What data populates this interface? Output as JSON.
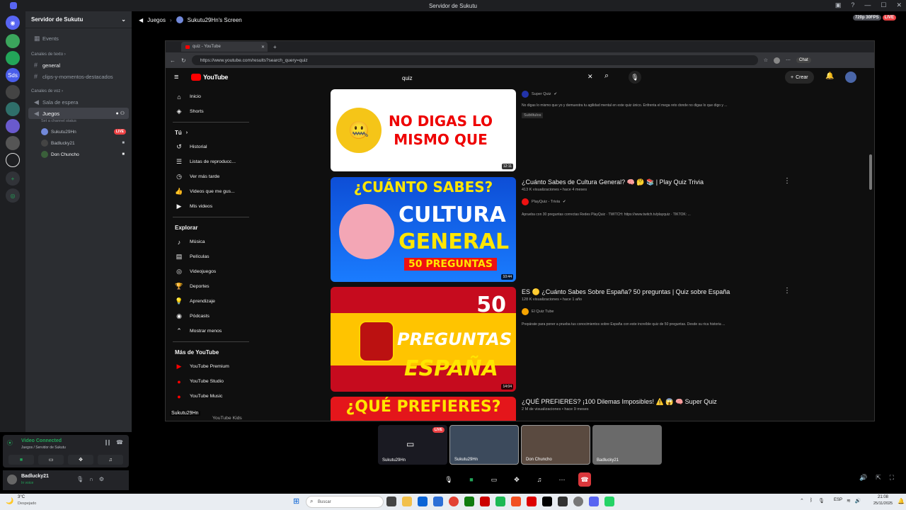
{
  "window": {
    "title": "Servidor de Sukutu"
  },
  "server": {
    "name": "Servidor de Sukutu",
    "events_label": "Events"
  },
  "channels": {
    "text_category": "Canales de texto",
    "text": [
      "general",
      "clips-y-momentos-destacados"
    ],
    "voice_category": "Canales de voz",
    "voice": [
      "Sala de espera",
      "Juegos"
    ],
    "juegos_status": "Set a channel status",
    "voice_users": [
      {
        "name": "Sukutu29Hn",
        "live": "LIVE"
      },
      {
        "name": "Badlucky21",
        "live": ""
      },
      {
        "name": "Don Chuncho",
        "live": ""
      }
    ]
  },
  "voice_panel": {
    "status": "Video Connected",
    "location": "Juegos / Servidor de Sukutu"
  },
  "user_panel": {
    "name": "Badlucky21",
    "status": "In voice"
  },
  "topbar": {
    "channel": "Juegos",
    "screen": "Sukutu29Hn's Screen",
    "quality": "720p 30FPS",
    "live": "LIVE"
  },
  "browser": {
    "tab_title": "quiz - YouTube",
    "url": "https://www.youtube.com/results?search_query=quiz"
  },
  "youtube": {
    "logo": "YouTube",
    "search_value": "quiz",
    "create_label": "Crear",
    "chat_label": "Chat",
    "nav_main": [
      "Inicio",
      "Shorts"
    ],
    "you_label": "Tú",
    "nav_you": [
      "Historial",
      "Listas de reproducc...",
      "Ver más tarde",
      "Videos que me gus...",
      "Mis videos"
    ],
    "explore_label": "Explorar",
    "nav_explore": [
      "Música",
      "Películas",
      "Videojuegos",
      "Deportes",
      "Aprendizaje",
      "Pódcasts",
      "Mostrar menos"
    ],
    "more_label": "Más de YouTube",
    "nav_more": [
      "YouTube Premium",
      "YouTube Studio",
      "YouTube Music",
      "YouTube Kids"
    ],
    "results": [
      {
        "title": "",
        "thumb_text": [
          "NO DIGAS LO",
          "MISMO QUE"
        ],
        "duration": "12:11",
        "channel": "Super Quiz",
        "meta": "",
        "desc": "No digas lo mismo que yo y demuestra tu agilidad mental en este quiz único. Enfrenta el mega reto donde no digas lo que digo y ...",
        "badge": "Subtítulos"
      },
      {
        "title": "¿Cuánto Sabes de Cultura General? 🧠 🤔 📚 | Play Quiz Trivia",
        "thumb_text": [
          "¿CUÁNTO SABES?",
          "CULTURA",
          "GENERAL",
          "50 PREGUNTAS"
        ],
        "duration": "10:44",
        "channel": "PlayQuiz - Trivia",
        "meta": "413 K visualizaciones • hace 4 meses",
        "desc": "Aprueba con 30 preguntas correctas Redes PlayQuiz · TWITCH: https://www.twitch.tv/playquiz · TIKTOK: ..."
      },
      {
        "title": "ES 🟡 ¿Cuánto Sabes Sobre España? 50 preguntas | Quiz sobre España",
        "thumb_text": [
          "50",
          "PREGUNTAS",
          "ESPAÑA"
        ],
        "duration": "14:04",
        "channel": "El Quiz Tube",
        "meta": "128 K visualizaciones • hace 1 año",
        "desc": "Prepárate para poner a prueba tus conocimientos sobre España con este increíble quiz de 50 preguntas. Desde su rica historia ..."
      },
      {
        "title": "¿QUÉ PREFIERES? ¡100 Dilemas Imposibles! ⚠️ 😱 🧠 Super Quiz",
        "thumb_text": [
          "¿QUÉ PREFIERES?"
        ],
        "duration": "",
        "channel": "",
        "meta": "2 M de visualizaciones • hace 9 meses",
        "desc": ""
      }
    ],
    "stream_owner": "Sukutu29Hn"
  },
  "participants": [
    {
      "name": "Sukutu29Hn",
      "live": "LIVE"
    },
    {
      "name": "Sukutu29Hn",
      "live": ""
    },
    {
      "name": "Don Chuncho",
      "live": ""
    },
    {
      "name": "Badlucky21",
      "live": ""
    }
  ],
  "taskbar": {
    "weather_temp": "3°C",
    "weather_text": "Despejado",
    "search_placeholder": "Buscar",
    "lang": "ESP",
    "time": "21:08",
    "date": "25/11/2025"
  },
  "colors": {
    "discord_bg": "#2b2d31",
    "rail_bg": "#1e1f22",
    "live_red": "#ed4245",
    "yt_bg": "#0f0f0f",
    "green": "#23a559"
  }
}
